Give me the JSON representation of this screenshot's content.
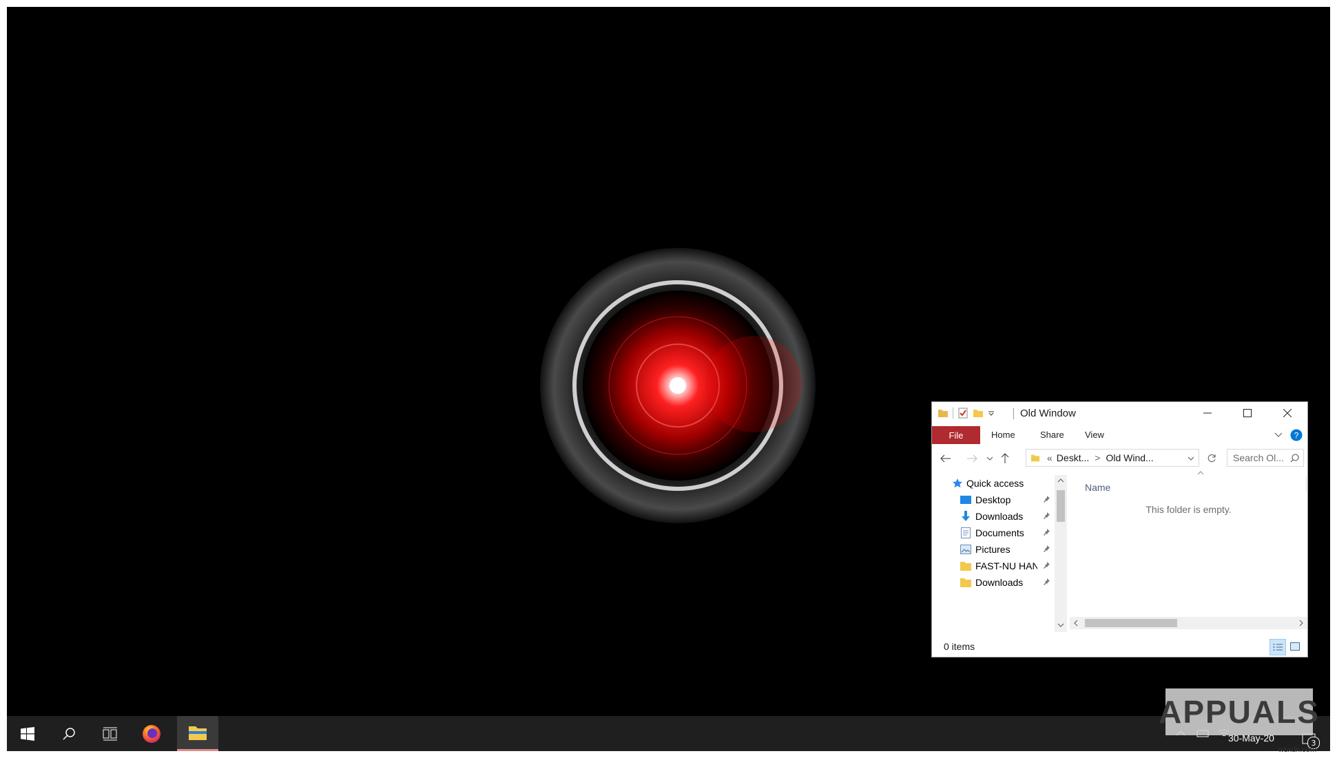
{
  "explorer": {
    "title": "Old Window",
    "ribbon_tabs": [
      "File",
      "Home",
      "Share",
      "View"
    ],
    "address": {
      "sep": "«",
      "crumb1": "Deskt...",
      "arrow": ">",
      "crumb2": "Old Wind..."
    },
    "search_placeholder": "Search Ol...",
    "nav": {
      "quick_access": "Quick access",
      "items": [
        "Desktop",
        "Downloads",
        "Documents",
        "Pictures",
        "FAST-NU HAN",
        "Downloads"
      ]
    },
    "column_name": "Name",
    "empty_message": "This folder is empty.",
    "status": "0 items"
  },
  "taskbar": {
    "date": "30-May-20",
    "notification_count": "3",
    "apps": [
      "start-icon",
      "search-icon",
      "task-view-icon",
      "firefox-icon",
      "file-explorer-icon"
    ]
  },
  "watermark": {
    "text": "APPUALS",
    "site": "wsxdn.com"
  },
  "colors": {
    "file_tab": "#b02a30",
    "taskbar": "#1f1f1f",
    "accent_blue": "#0078d7"
  }
}
